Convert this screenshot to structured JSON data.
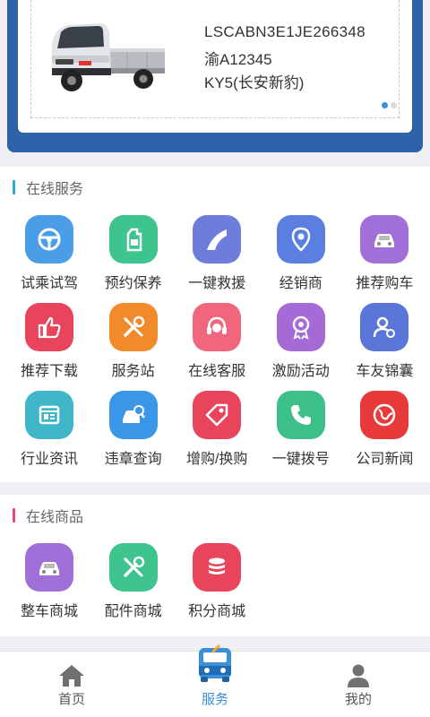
{
  "vehicle": {
    "vin": "LSCABN3E1JE266348",
    "plate": "渝A12345",
    "model": "KY5(长安新豹)",
    "carousel_dots": 2,
    "active_dot": 0
  },
  "online_services": {
    "title": "在线服务",
    "accent": "#29a8e0",
    "items": [
      {
        "label": "试乘试驾",
        "icon": "steering-wheel-icon",
        "color": "#4a9ee8"
      },
      {
        "label": "预约保养",
        "icon": "oil-bottle-icon",
        "color": "#3dc48f"
      },
      {
        "label": "一键救援",
        "icon": "road-icon",
        "color": "#6e7ddc"
      },
      {
        "label": "经销商",
        "icon": "location-pin-icon",
        "color": "#5b7fe0"
      },
      {
        "label": "推荐购车",
        "icon": "car-icon",
        "color": "#a070d8"
      },
      {
        "label": "推荐下载",
        "icon": "thumbs-up-icon",
        "color": "#e8455c"
      },
      {
        "label": "服务站",
        "icon": "tools-icon",
        "color": "#f08a2a"
      },
      {
        "label": "在线客服",
        "icon": "headset-icon",
        "color": "#f0667d"
      },
      {
        "label": "激励活动",
        "icon": "medal-icon",
        "color": "#a66ad6"
      },
      {
        "label": "车友锦囊",
        "icon": "users-icon",
        "color": "#5a77d8"
      },
      {
        "label": "行业资讯",
        "icon": "news-icon",
        "color": "#3fb7c9"
      },
      {
        "label": "违章查询",
        "icon": "car-search-icon",
        "color": "#3a96e6"
      },
      {
        "label": "增购/换购",
        "icon": "tag-icon",
        "color": "#e8455c"
      },
      {
        "label": "一键拨号",
        "icon": "phone-icon",
        "color": "#3dbf8a"
      },
      {
        "label": "公司新闻",
        "icon": "globe-icon",
        "color": "#e83a3a"
      }
    ]
  },
  "online_goods": {
    "title": "在线商品",
    "accent": "#e8457a",
    "items": [
      {
        "label": "整车商城",
        "icon": "car-icon",
        "color": "#a070d8"
      },
      {
        "label": "配件商城",
        "icon": "tools-icon",
        "color": "#3dc48f"
      },
      {
        "label": "积分商城",
        "icon": "coins-icon",
        "color": "#e8455c"
      }
    ]
  },
  "tabbar": {
    "items": [
      {
        "label": "首页",
        "icon": "home-icon"
      },
      {
        "label": "服务",
        "icon": "service-car-icon"
      },
      {
        "label": "我的",
        "icon": "person-icon"
      }
    ],
    "active_index": 1,
    "active_color": "#3a8fd6"
  }
}
